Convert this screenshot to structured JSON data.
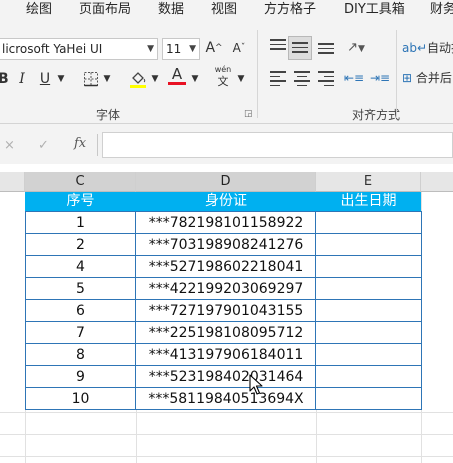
{
  "ribbon_tabs": [
    "绘图",
    "页面布局",
    "数据",
    "视图",
    "方方格子",
    "DIY工具箱",
    "财务"
  ],
  "font": {
    "name": "licrosoft YaHei UI",
    "size": "11",
    "increase_label": "A^",
    "decrease_label": "A˅",
    "wen_label": "wén",
    "wen_sub": "文",
    "group_label": "字体"
  },
  "alignment": {
    "wrap_label": "自动换",
    "merge_label": "合并后",
    "group_label": "对齐方式"
  },
  "formula_bar": {
    "cancel_icon": "×",
    "confirm_icon": "✓",
    "fx_label": "fx",
    "value": ""
  },
  "columns": [
    "C",
    "D",
    "E"
  ],
  "table": {
    "headers": [
      "序号",
      "身份证",
      "出生日期"
    ],
    "rows": [
      {
        "no": "1",
        "id": "***782198101158922",
        "birth": ""
      },
      {
        "no": "2",
        "id": "***703198908241276",
        "birth": ""
      },
      {
        "no": "4",
        "id": "***527198602218041",
        "birth": ""
      },
      {
        "no": "5",
        "id": "***422199203069297",
        "birth": ""
      },
      {
        "no": "6",
        "id": "***727197901043155",
        "birth": ""
      },
      {
        "no": "7",
        "id": "***225198108095712",
        "birth": ""
      },
      {
        "no": "8",
        "id": "***413197906184011",
        "birth": ""
      },
      {
        "no": "9",
        "id": "***523198402031464",
        "birth": ""
      },
      {
        "no": "10",
        "id": "***58119840513694X",
        "birth": ""
      }
    ]
  },
  "colors": {
    "header_fill": "#00b0f0",
    "table_border": "#2e75b6",
    "font_color_bar": "#e81123",
    "highlight_bar": "#ffff00"
  }
}
